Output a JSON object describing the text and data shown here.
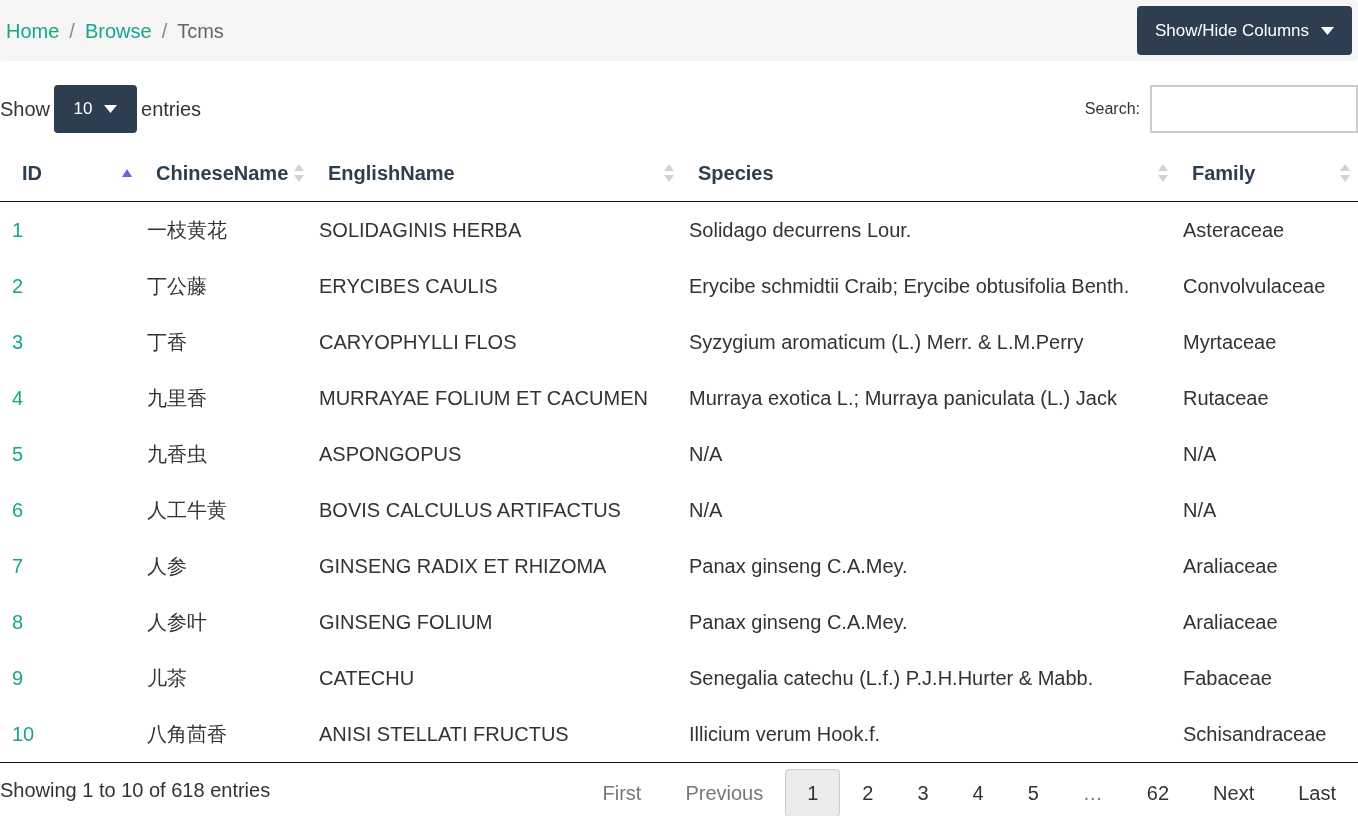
{
  "breadcrumb_separator": "/",
  "breadcrumb": [
    {
      "label": "Home",
      "current": false
    },
    {
      "label": "Browse",
      "current": false
    },
    {
      "label": "Tcms",
      "current": true
    }
  ],
  "columns_button": {
    "label": "Show/Hide Columns"
  },
  "length": {
    "before": "Show",
    "value": "10",
    "after": "entries"
  },
  "search": {
    "label": "Search:"
  },
  "table": {
    "columns": [
      {
        "label": "ID",
        "sorted": true
      },
      {
        "label": "ChineseName",
        "sorted": false
      },
      {
        "label": "EnglishName",
        "sorted": false
      },
      {
        "label": "Species",
        "sorted": false
      },
      {
        "label": "Family",
        "sorted": false
      }
    ],
    "rows": [
      [
        "1",
        "一枝黄花",
        "SOLIDAGINIS HERBA",
        "Solidago decurrens Lour.",
        "Asteraceae"
      ],
      [
        "2",
        "丁公藤",
        "ERYCIBES CAULIS",
        "Erycibe schmidtii Craib; Erycibe obtusifolia Benth.",
        "Convolvulaceae"
      ],
      [
        "3",
        "丁香",
        "CARYOPHYLLI FLOS",
        "Syzygium aromaticum (L.) Merr. & L.M.Perry",
        "Myrtaceae"
      ],
      [
        "4",
        "九里香",
        "MURRAYAE FOLIUM ET CACUMEN",
        "Murraya exotica L.; Murraya paniculata (L.) Jack",
        "Rutaceae"
      ],
      [
        "5",
        "九香虫",
        "ASPONGOPUS",
        "N/A",
        "N/A"
      ],
      [
        "6",
        "人工牛黄",
        "BOVIS CALCULUS ARTIFACTUS",
        "N/A",
        "N/A"
      ],
      [
        "7",
        "人参",
        "GINSENG RADIX ET RHIZOMA",
        "Panax ginseng C.A.Mey.",
        "Araliaceae"
      ],
      [
        "8",
        "人参叶",
        "GINSENG FOLIUM",
        "Panax ginseng C.A.Mey.",
        "Araliaceae"
      ],
      [
        "9",
        "儿茶",
        "CATECHU",
        "Senegalia catechu (L.f.) P.J.H.Hurter & Mabb.",
        "Fabaceae"
      ],
      [
        "10",
        "八角茴香",
        "ANISI STELLATI FRUCTUS",
        "Illicium verum Hook.f.",
        "Schisandraceae"
      ]
    ]
  },
  "info": "Showing 1 to 10 of 618 entries",
  "pagination": [
    {
      "label": "First",
      "selected": false,
      "disabled": true
    },
    {
      "label": "Previous",
      "selected": false,
      "disabled": true
    },
    {
      "label": "1",
      "selected": true,
      "disabled": false
    },
    {
      "label": "2",
      "selected": false,
      "disabled": false
    },
    {
      "label": "3",
      "selected": false,
      "disabled": false
    },
    {
      "label": "4",
      "selected": false,
      "disabled": false
    },
    {
      "label": "5",
      "selected": false,
      "disabled": false
    },
    {
      "label": "…",
      "selected": false,
      "disabled": true
    },
    {
      "label": "62",
      "selected": false,
      "disabled": false
    },
    {
      "label": "Next",
      "selected": false,
      "disabled": false
    },
    {
      "label": "Last",
      "selected": false,
      "disabled": false
    }
  ]
}
